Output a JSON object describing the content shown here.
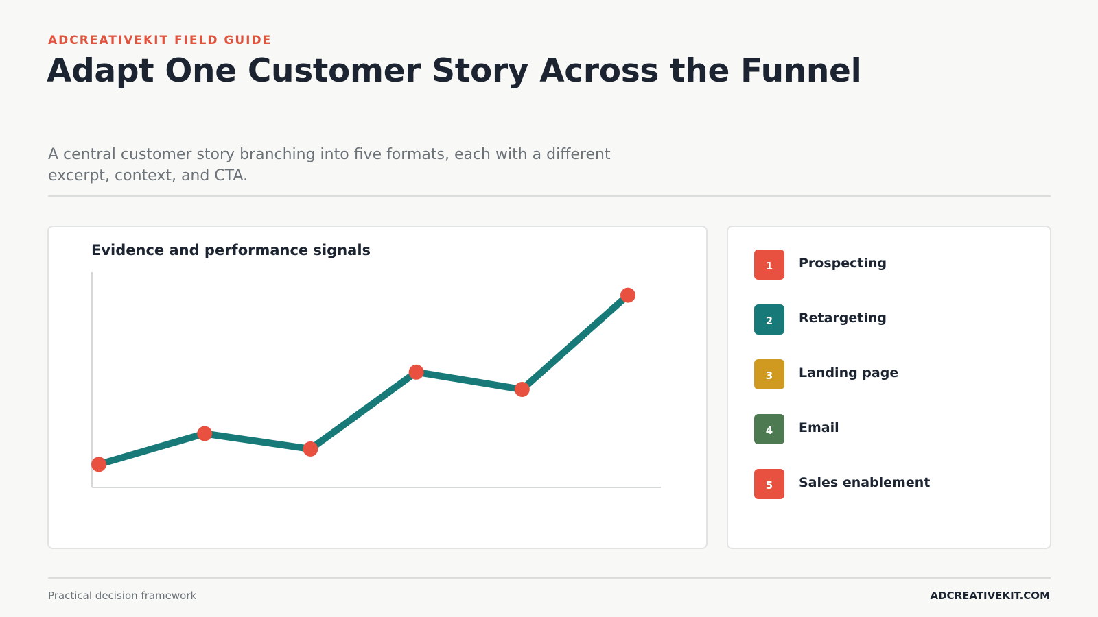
{
  "header": {
    "eyebrow": "ADCREATIVEKIT FIELD GUIDE",
    "title": "Adapt One Customer Story Across the Funnel",
    "subtitle": "A central customer story branching into five formats, each with a different excerpt, context, and CTA."
  },
  "chart_data": {
    "type": "line",
    "title": "Evidence and performance signals",
    "xlabel": "",
    "ylabel": "",
    "x": [
      1,
      2,
      3,
      4,
      5,
      6
    ],
    "values": [
      12,
      28,
      20,
      60,
      51,
      100
    ],
    "ylim": [
      0,
      112
    ],
    "grid": false,
    "line_color": "#177a78",
    "marker_color": "#e8503f"
  },
  "legend": {
    "items": [
      {
        "number": "1",
        "label": "Prospecting",
        "color": "#e8503f"
      },
      {
        "number": "2",
        "label": "Retargeting",
        "color": "#177a78"
      },
      {
        "number": "3",
        "label": "Landing page",
        "color": "#cf9a1f"
      },
      {
        "number": "4",
        "label": "Email",
        "color": "#4e7a52"
      },
      {
        "number": "5",
        "label": "Sales enablement",
        "color": "#e8503f"
      }
    ]
  },
  "footer": {
    "left": "Practical decision framework",
    "right": "ADCREATIVEKIT.COM"
  }
}
